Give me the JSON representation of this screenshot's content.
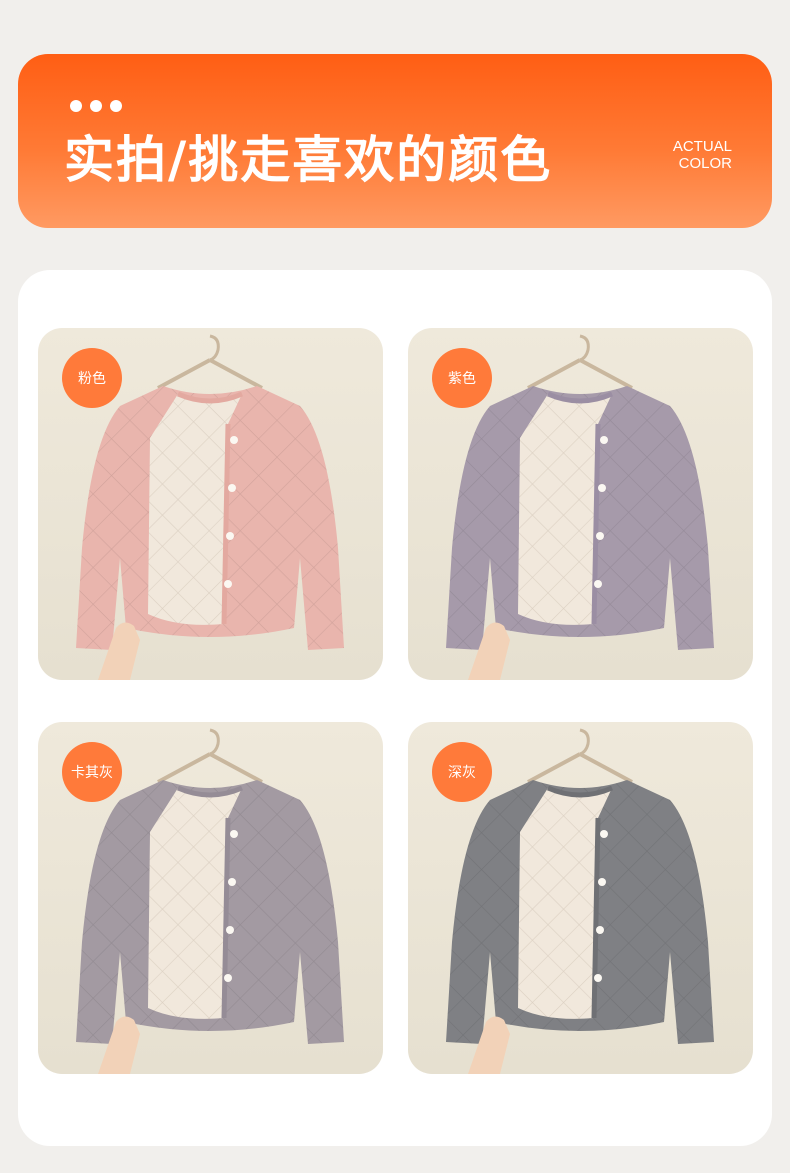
{
  "header": {
    "title": "实拍/挑走喜欢的颜色",
    "subtitle_en_line1": "ACTUAL",
    "subtitle_en_line2": "COLOR"
  },
  "products": [
    {
      "label": "粉色",
      "jacket_color": "#e9b5ad",
      "trim_color": "#e3a9a0"
    },
    {
      "label": "紫色",
      "jacket_color": "#a69aaa",
      "trim_color": "#9b8ea3"
    },
    {
      "label": "卡其灰",
      "jacket_color": "#a39aa2",
      "trim_color": "#958c96"
    },
    {
      "label": "深灰",
      "jacket_color": "#7f8084",
      "trim_color": "#6f7074"
    }
  ],
  "colors": {
    "banner_accent": "#ff5e14",
    "badge": "#ff7a3a",
    "lining": "#f1e8dc"
  }
}
